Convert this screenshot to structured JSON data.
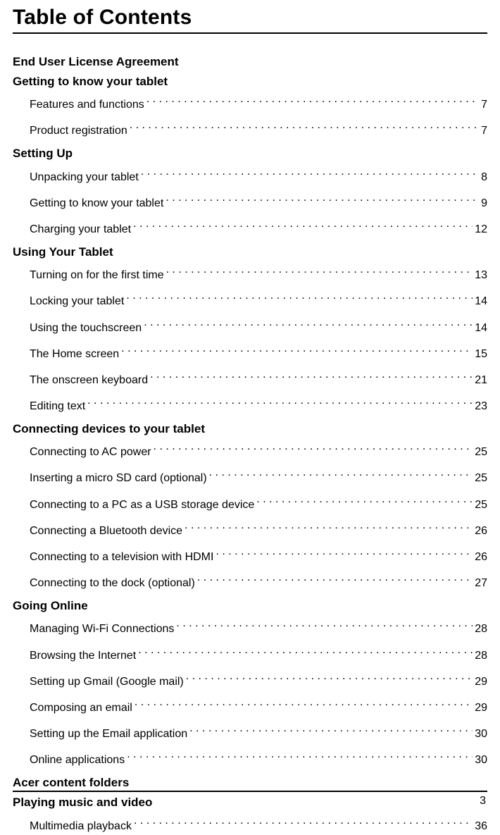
{
  "title": "Table of Contents",
  "page_number": "3",
  "sections": [
    {
      "heading": "End User License Agreement",
      "entries": []
    },
    {
      "heading": "Getting to know your tablet",
      "entries": [
        {
          "label": "Features and functions",
          "page": "7"
        },
        {
          "label": "Product registration",
          "page": "7"
        }
      ]
    },
    {
      "heading": "Setting Up",
      "entries": [
        {
          "label": "Unpacking your tablet",
          "page": "8"
        },
        {
          "label": "Getting to know your tablet",
          "page": "9"
        },
        {
          "label": "Charging your tablet",
          "page": "12"
        }
      ]
    },
    {
      "heading": "Using Your Tablet",
      "entries": [
        {
          "label": "Turning on for the first time",
          "page": "13"
        },
        {
          "label": "Locking your tablet",
          "page": "14"
        },
        {
          "label": "Using the touchscreen",
          "page": "14"
        },
        {
          "label": "The Home screen",
          "page": "15"
        },
        {
          "label": "The onscreen keyboard",
          "page": "21"
        },
        {
          "label": "Editing text",
          "page": "23"
        }
      ]
    },
    {
      "heading": "Connecting devices to your tablet",
      "entries": [
        {
          "label": "Connecting to AC power",
          "page": "25"
        },
        {
          "label": "Inserting a micro SD card (optional)",
          "page": "25"
        },
        {
          "label": "Connecting to a PC as a USB storage device",
          "page": "25"
        },
        {
          "label": "Connecting a Bluetooth device",
          "page": "26"
        },
        {
          "label": "Connecting to a television with HDMI",
          "page": "26"
        },
        {
          "label": "Connecting to the dock (optional)",
          "page": "27"
        }
      ]
    },
    {
      "heading": "Going Online",
      "entries": [
        {
          "label": "Managing Wi-Fi Connections",
          "page": "28"
        },
        {
          "label": "Browsing the Internet",
          "page": "28"
        },
        {
          "label": "Setting up Gmail (Google mail)",
          "page": "29"
        },
        {
          "label": "Composing an email",
          "page": "29"
        },
        {
          "label": "Setting up the Email application",
          "page": "30"
        },
        {
          "label": "Online applications",
          "page": "30"
        }
      ]
    },
    {
      "heading": "Acer content folders",
      "entries": []
    },
    {
      "heading": "Playing music and video",
      "entries": [
        {
          "label": "Multimedia playback",
          "page": "36"
        }
      ]
    }
  ]
}
